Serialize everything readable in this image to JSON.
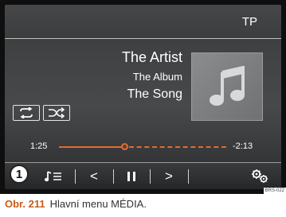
{
  "header": {
    "source_label": "TP"
  },
  "now_playing": {
    "artist": "The Artist",
    "album": "The Album",
    "song": "The Song",
    "artwork_icon": "music-note-icon"
  },
  "modes": {
    "repeat_icon": "repeat-icon",
    "shuffle_icon": "shuffle-icon"
  },
  "playback": {
    "elapsed": "1:25",
    "remaining": "-2:13",
    "progress_fraction": 0.39,
    "accent_color": "#e46b2b"
  },
  "controls": {
    "playlist_icon": "playlist-icon",
    "previous_label": "<",
    "pause_label": "II",
    "next_label": ">",
    "settings_icon": "gears-icon"
  },
  "callout_number": "1",
  "image_code": "BRS-022",
  "caption": {
    "figure_number": "Obr. 211",
    "text": "Hlavní menu MÉDIA."
  }
}
